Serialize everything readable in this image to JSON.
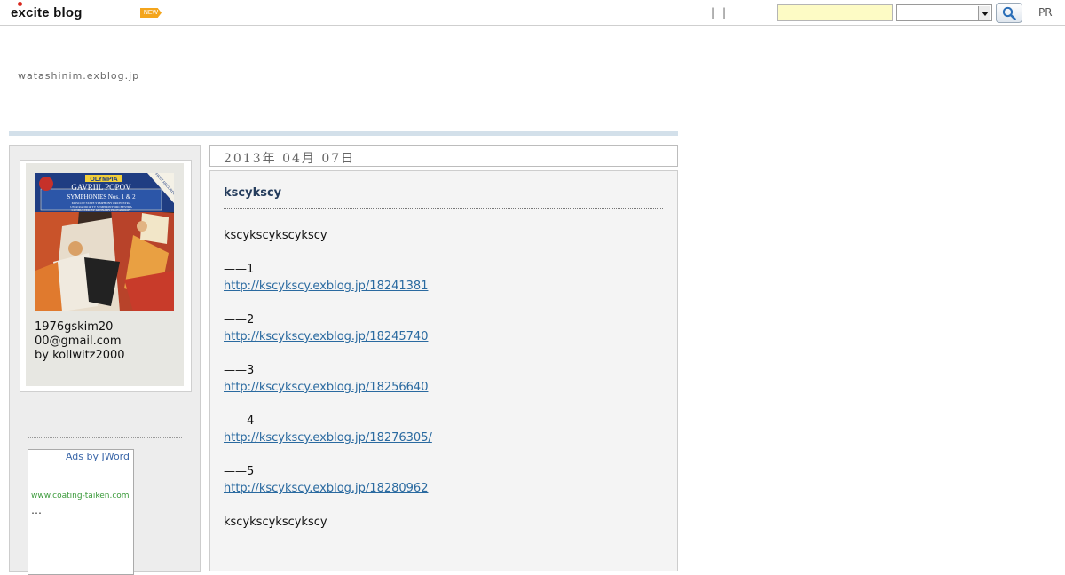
{
  "topbar": {
    "logo": {
      "pre": "e",
      "x": "x",
      "post": "cite blog"
    },
    "new_badge": "NEW",
    "separators": [
      "|",
      "|"
    ],
    "search": {
      "value": "",
      "select_value": ""
    },
    "pr": "PR"
  },
  "header": {
    "url": "watashinim.exblog.jp"
  },
  "sidebar": {
    "profile_line1": "1976gskim20",
    "profile_line2": "00@gmail.com",
    "profile_line3": "by kollwitz2000",
    "album": {
      "label": "OLYMPIA",
      "artist": "GAVRIIL POPOV",
      "title": "SYMPHONIES Nos. 1 & 2",
      "corner": "FIRST RECORDING",
      "credits": [
        "MOSCOW STATE SYMPHONY ORCHESTRA",
        "USSR RADIO & TV SYMPHONY ORCHESTRA",
        "CONDUCTED BY GENNADY PROVATOROV"
      ]
    },
    "ad": {
      "label": "Ads by JWord",
      "url": "www.coating-taiken.com",
      "dots": "…"
    }
  },
  "post": {
    "date": "2013年 04月 07日",
    "title": "kscykscy",
    "intro": "kscykscykscykscy",
    "items": [
      {
        "label": "——1",
        "link": "http://kscykscy.exblog.jp/18241381"
      },
      {
        "label": "——2",
        "link": "http://kscykscy.exblog.jp/18245740"
      },
      {
        "label": "——3",
        "link": "http://kscykscy.exblog.jp/18256640"
      },
      {
        "label": "——4",
        "link": "http://kscykscy.exblog.jp/18276305/"
      },
      {
        "label": "——5",
        "link": "http://kscykscy.exblog.jp/18280962"
      }
    ],
    "outro": "kscykscykscykscy"
  },
  "colors": {
    "accent_link": "#2a6aa0",
    "title": "#243c5c",
    "rule": "#d3e0ea",
    "search_field": "#fdfbc5",
    "badge": "#f4a51c"
  }
}
